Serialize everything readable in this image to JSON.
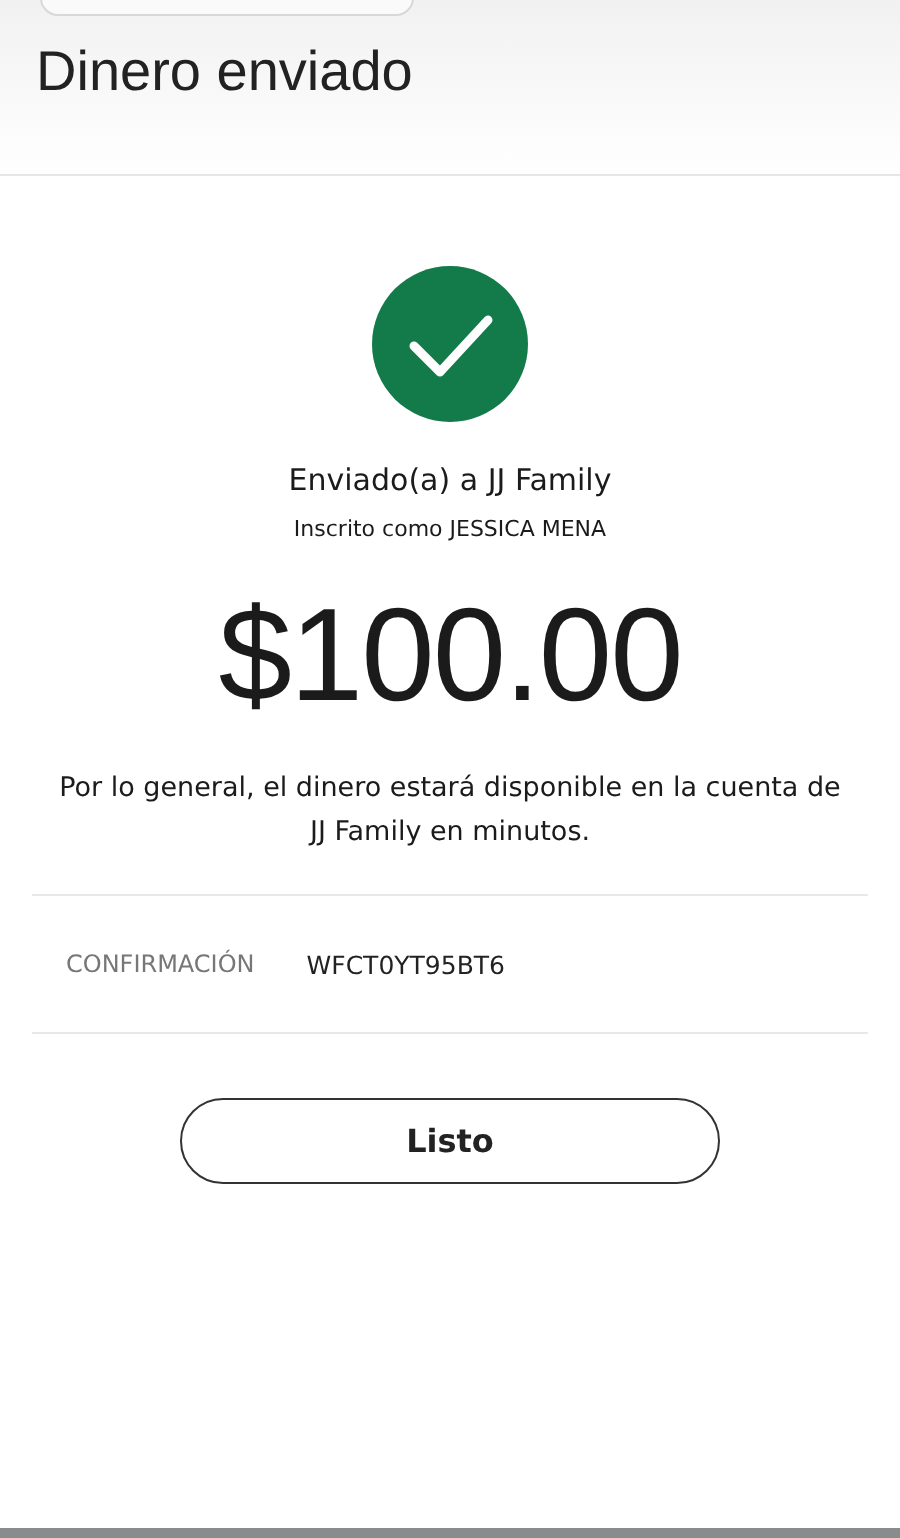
{
  "header": {
    "title": "Dinero enviado"
  },
  "result": {
    "recipient": "Enviado(a) a JJ Family",
    "enrolled": "Inscrito como JESSICA MENA",
    "amount": "$100.00",
    "note": "Por lo general, el dinero estará disponible en la cuenta de JJ Family en minutos."
  },
  "confirmation": {
    "label": "CONFIRMACIÓN",
    "code": "WFCT0YT95BT6"
  },
  "buttons": [
    "Listo"
  ]
}
